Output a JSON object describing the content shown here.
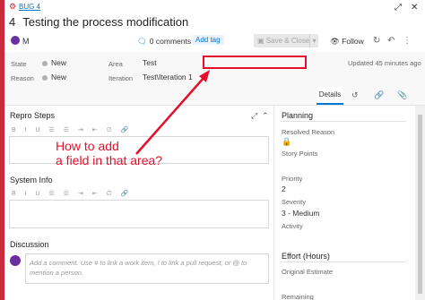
{
  "header": {
    "bug_icon": "bug-icon",
    "bug_link": "BUG 4",
    "work_item_id": "4",
    "title": "Testing the process modification",
    "expand_icon": "expand-icon",
    "close_icon": "close-icon"
  },
  "toolbar": {
    "assignee": "M",
    "comments_label": "0 comments",
    "add_tag_label": "Add tag",
    "save_close_label": "Save & Close",
    "follow_label": "Follow"
  },
  "fields": {
    "state_label": "State",
    "state_value": "New",
    "reason_label": "Reason",
    "reason_value": "New",
    "area_label": "Area",
    "area_value": "Test",
    "iteration_label": "Iteration",
    "iteration_value": "Test\\Iteration 1",
    "updated": "Updated 45 minutes ago"
  },
  "tabs": {
    "details_label": "Details"
  },
  "sections": {
    "repro_steps": "Repro Steps",
    "system_info": "System Info",
    "discussion": "Discussion",
    "discussion_placeholder": "Add a comment. Use # to link a work item, ! to link a pull request, or @ to mention a person."
  },
  "planning": {
    "title": "Planning",
    "resolved_reason_label": "Resolved Reason",
    "story_points_label": "Story Points",
    "priority_label": "Priority",
    "priority_value": "2",
    "severity_label": "Severity",
    "severity_value": "3 - Medium",
    "activity_label": "Activity"
  },
  "effort": {
    "title": "Effort (Hours)",
    "original_estimate_label": "Original Estimate",
    "remaining_label": "Remaining"
  },
  "annotation": {
    "line1": "How to add",
    "line2": "a field in that area?",
    "color": "#e4102b"
  },
  "colors": {
    "bug_red": "#cc293d",
    "accent_blue": "#0078d4",
    "avatar_purple": "#6b2fa0"
  }
}
